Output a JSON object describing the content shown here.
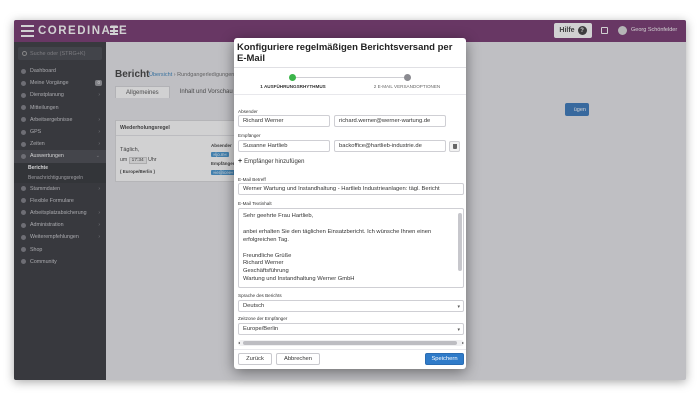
{
  "app": {
    "logo_text": "COREDINATE"
  },
  "topbar": {
    "help_label": "Hilfe",
    "help_icon": "question-circle-icon",
    "user_name": "Georg Schönfelder"
  },
  "sidebar": {
    "search_placeholder": "Suche oder (STRG+K)",
    "items": [
      {
        "label": "Dashboard",
        "icon": "dashboard-icon"
      },
      {
        "label": "Meine Vorgänge",
        "badge": "0",
        "icon": "tasks-icon"
      },
      {
        "label": "Dienstplanung",
        "icon": "calendar-icon"
      },
      {
        "label": "Mitteilungen",
        "icon": "message-icon"
      },
      {
        "label": "Arbeitsergebnisse",
        "icon": "results-icon"
      },
      {
        "label": "GPS",
        "icon": "gps-icon"
      },
      {
        "label": "Zeiten",
        "icon": "clock-icon"
      },
      {
        "label": "Auswertungen",
        "icon": "reports-icon"
      },
      {
        "label": "Stammdaten",
        "icon": "database-icon"
      },
      {
        "label": "Flexible Formulare",
        "icon": "form-icon"
      },
      {
        "label": "Arbeitsplatzabsicherung",
        "icon": "shield-icon"
      },
      {
        "label": "Administration",
        "icon": "gear-icon"
      },
      {
        "label": "Weiterempfehlungen",
        "icon": "share-icon"
      },
      {
        "label": "Shop",
        "icon": "cart-icon"
      },
      {
        "label": "Community",
        "icon": "community-icon"
      }
    ],
    "sub_items": [
      "Berichte",
      "Benachrichtigungsregeln"
    ]
  },
  "page": {
    "title": "Bericht",
    "breadcrumb_link": "Übersicht",
    "breadcrumb_rest": "› Rundgangerledigungen",
    "tabs": [
      "Allgemeines",
      "Inhalt und Vorschau"
    ],
    "button_partial": "ügen",
    "panel": {
      "title": "Wiederholungsregel",
      "line1": "Täglich,",
      "line2_prefix": "um",
      "line2_time": "17:34",
      "line2_suffix": "Uhr",
      "line3": "( Europe/Berlin )",
      "label1": "Absender",
      "chip1": "»ljo.m«",
      "label2": "Empfänger",
      "chip2": "»ie@icee«"
    }
  },
  "modal": {
    "title": "Konfiguriere regelmäßigen Berichtsversand per E-Mail",
    "steps": [
      "1  AUSFÜHRUNGSRHYTHMUS",
      "2  E-MAIL VERSANDOPTIONEN"
    ],
    "sender_label": "Absender",
    "sender_name": "Richard Werner",
    "sender_email": "richard.werner@werner-wartung.de",
    "recipient_label": "Empfänger",
    "recipient_name": "Susanne Hartlieb",
    "recipient_email": "backoffice@hartlieb-industrie.de",
    "add_recipient": "Empfänger hinzufügen",
    "subject_label": "E-Mail Betreff",
    "subject_value": "Werner Wartung und Instandhaltung - Hartlieb Industrieanlagen: tägl. Bericht",
    "body_label": "E-Mail Textinhalt",
    "body_lines": [
      "Sehr geehrte Frau Hartlieb,",
      "",
      "anbei erhalten Sie den täglichen Einsatzbericht. Ich wünsche Ihnen einen",
      "erfolgreichen Tag.",
      "",
      "Freundliche Grüße",
      "Richard Werner",
      "Geschäftsführung",
      "Wartung und Instandhaltung Werner GmbH"
    ],
    "language_label": "Sprache des Berichts",
    "language_value": "Deutsch",
    "timezone_label": "Zeitzone der Empfänger",
    "timezone_value": "Europe/Berlin",
    "back_button": "Zurück",
    "cancel_button": "Abbrechen",
    "save_button": "Speichern",
    "colors": {
      "primary": "#2f7bc9",
      "step_done": "#3bb54a",
      "topbar": "#6e2a67"
    }
  }
}
